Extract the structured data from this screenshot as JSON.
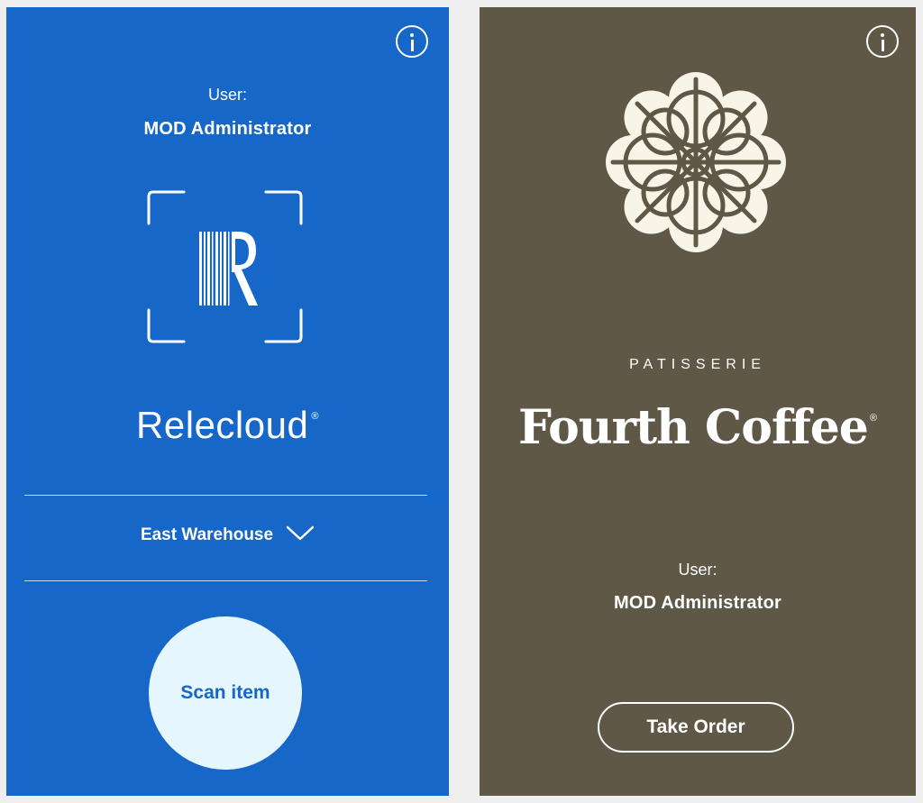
{
  "relecloud": {
    "user_label": "User:",
    "user_name": "MOD Administrator",
    "logo_letter": "R",
    "brand_name": "Relecloud",
    "registered_mark": "®",
    "location": "East Warehouse",
    "scan_button_label": "Scan item",
    "colors": {
      "background": "#1667c7",
      "scan_button_bg": "#e6f6ff",
      "scan_button_text": "#1667c7"
    },
    "icons": [
      "info-icon",
      "scan-frame-icon",
      "chevron-down-icon"
    ]
  },
  "fourth_coffee": {
    "tagline": "PATISSERIE",
    "brand_name": "Fourth Coffee",
    "registered_mark": "®",
    "user_label": "User:",
    "user_name": "MOD Administrator",
    "order_button_label": "Take Order",
    "colors": {
      "background": "#5f5847",
      "emblem": "#f8f4e8"
    },
    "icons": [
      "info-icon",
      "emblem-logo"
    ]
  }
}
